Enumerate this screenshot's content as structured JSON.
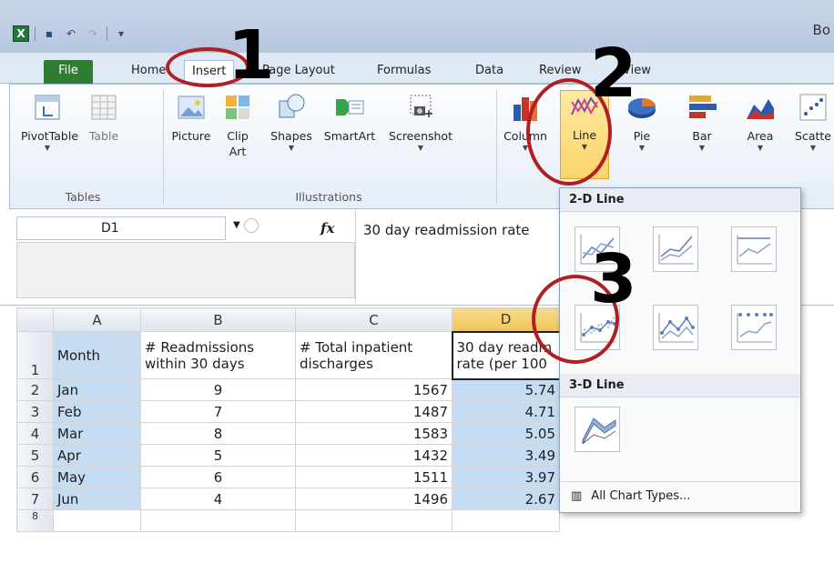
{
  "window": {
    "title": "Bo"
  },
  "tabs": [
    "File",
    "Home",
    "Insert",
    "Page Layout",
    "Formulas",
    "Data",
    "Review",
    "View"
  ],
  "ribbon": {
    "tables": {
      "label": "Tables",
      "pivot": "PivotTable",
      "table": "Table"
    },
    "illustrations": {
      "label": "Illustrations",
      "picture": "Picture",
      "clip_art": "Clip Art",
      "shapes": "Shapes",
      "smartart": "SmartArt",
      "screenshot": "Screenshot"
    },
    "charts": {
      "column": "Column",
      "line": "Line",
      "pie": "Pie",
      "bar": "Bar",
      "area": "Area",
      "scatter": "Scatte"
    }
  },
  "formula_bar": {
    "cell": "D1",
    "fx": "fx",
    "value": "30 day readmission rate"
  },
  "sheet": {
    "columns": [
      "A",
      "B",
      "C",
      "D"
    ],
    "header_row": {
      "row": "1",
      "a": "Month",
      "b_line1": "# Readmissions",
      "b_line2": "within 30 days",
      "c_line1": "# Total inpatient",
      "c_line2": "discharges",
      "d_line1": "30 day readm",
      "d_line2": "rate (per 100"
    },
    "rows": [
      {
        "row": "2",
        "month": "Jan",
        "readm": "9",
        "total": "1567",
        "rate": "5.74"
      },
      {
        "row": "3",
        "month": "Feb",
        "readm": "7",
        "total": "1487",
        "rate": "4.71"
      },
      {
        "row": "4",
        "month": "Mar",
        "readm": "8",
        "total": "1583",
        "rate": "5.05"
      },
      {
        "row": "5",
        "month": "Apr",
        "readm": "5",
        "total": "1432",
        "rate": "3.49"
      },
      {
        "row": "6",
        "month": "May",
        "readm": "6",
        "total": "1511",
        "rate": "3.97"
      },
      {
        "row": "7",
        "month": "Jun",
        "readm": "4",
        "total": "1496",
        "rate": "2.67"
      }
    ],
    "next_row": "8"
  },
  "dropdown": {
    "section_2d": "2-D Line",
    "section_3d": "3-D Line",
    "all_types": "All Chart Types..."
  },
  "annotations": {
    "step1": "1",
    "step2": "2",
    "step3": "3"
  },
  "colors": {
    "annotation_red": "#b01f24",
    "file_tab_green": "#2e7d32",
    "selection_blue": "#c5dcf2"
  }
}
